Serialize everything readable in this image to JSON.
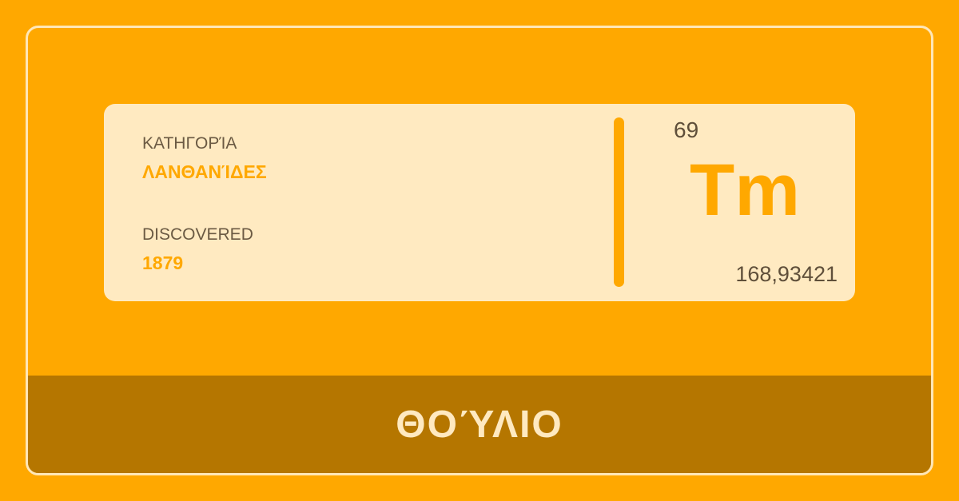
{
  "card": {
    "category_label": "ΚΑΤΗΓΟΡΊΑ",
    "category_value": "ΛΑΝΘΑΝΊΔΕΣ",
    "discovered_label": "DISCOVERED",
    "discovered_value": "1879"
  },
  "element": {
    "atomic_number": "69",
    "symbol": "Tm",
    "atomic_mass": "168,93421",
    "name": "ΘΟΎΛΙΟ"
  },
  "colors": {
    "background": "#ffa800",
    "card": "#ffeac1",
    "footer": "#b57600",
    "accent": "#ffa800",
    "text_dark": "#5f4f3a",
    "text_light": "#ffe9c0"
  }
}
